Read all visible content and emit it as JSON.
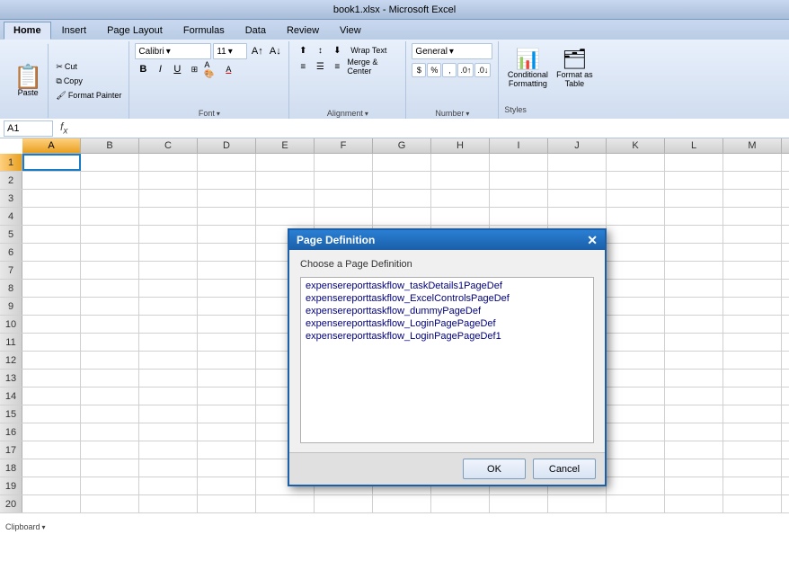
{
  "titlebar": {
    "title": "book1.xlsx - Microsoft Excel"
  },
  "ribbon": {
    "tabs": [
      {
        "label": "Home",
        "active": true
      },
      {
        "label": "Insert",
        "active": false
      },
      {
        "label": "Page Layout",
        "active": false
      },
      {
        "label": "Formulas",
        "active": false
      },
      {
        "label": "Data",
        "active": false
      },
      {
        "label": "Review",
        "active": false
      },
      {
        "label": "View",
        "active": false
      }
    ],
    "clipboard": {
      "paste_label": "Paste",
      "cut_label": "Cut",
      "copy_label": "Copy",
      "format_painter_label": "Format Painter",
      "group_label": "Clipboard"
    },
    "font": {
      "font_name": "Calibri",
      "font_size": "11",
      "bold_label": "B",
      "italic_label": "I",
      "underline_label": "U",
      "group_label": "Font"
    },
    "alignment": {
      "group_label": "Alignment",
      "wrap_text_label": "Wrap Text",
      "merge_center_label": "Merge & Center"
    },
    "number": {
      "format_label": "General",
      "group_label": "Number",
      "dollar_label": "$",
      "percent_label": "%",
      "comma_label": ",",
      "dec_inc_label": ".0",
      "dec_dec_label": ".00"
    },
    "styles": {
      "conditional_formatting_label": "Conditional Formatting",
      "format_as_table_label": "Format as Table",
      "group_label": "Styles"
    }
  },
  "formulabar": {
    "cell_ref": "A1",
    "formula_value": ""
  },
  "spreadsheet": {
    "columns": [
      "A",
      "B",
      "C",
      "D",
      "E",
      "F",
      "G",
      "H",
      "I",
      "J",
      "K",
      "L",
      "M"
    ],
    "rows": [
      1,
      2,
      3,
      4,
      5,
      6,
      7,
      8,
      9,
      10,
      11,
      12,
      13,
      14,
      15,
      16,
      17,
      18,
      19,
      20
    ]
  },
  "dialog": {
    "title": "Page Definition",
    "label": "Choose a Page Definition",
    "items": [
      {
        "label": "expensereporttaskflow_taskDetails1PageDef",
        "selected": false
      },
      {
        "label": "expensereporttaskflow_ExcelControlsPageDef",
        "selected": false
      },
      {
        "label": "expensereporttaskflow_dummyPageDef",
        "selected": false
      },
      {
        "label": "expensereporttaskflow_LoginPagePageDef",
        "selected": false
      },
      {
        "label": "expensereporttaskflow_LoginPagePageDef1",
        "selected": false
      }
    ],
    "ok_label": "OK",
    "cancel_label": "Cancel"
  }
}
